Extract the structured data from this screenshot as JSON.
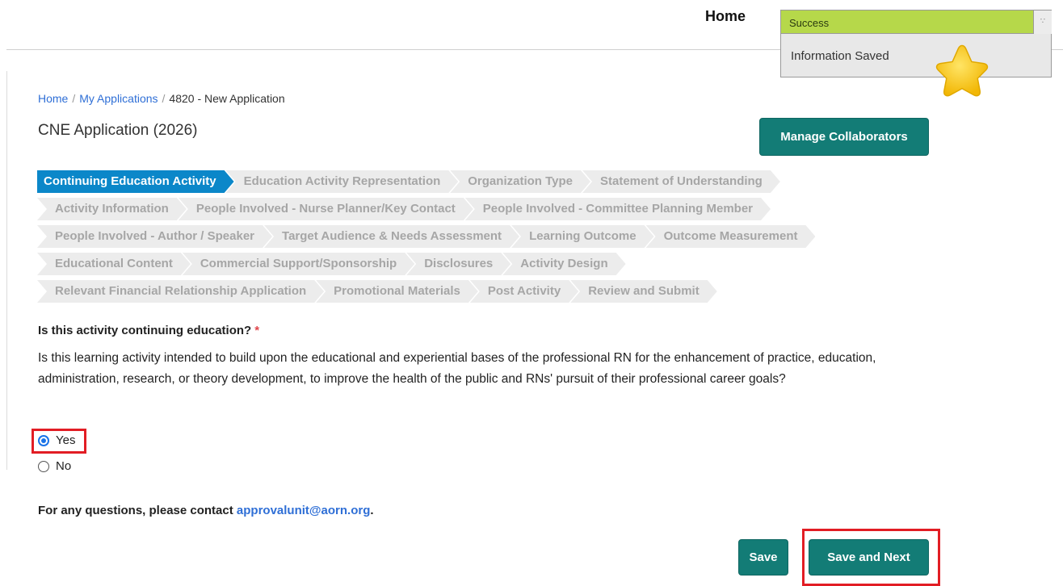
{
  "header": {
    "home_label": "Home"
  },
  "toast": {
    "title": "Success",
    "message": "Information Saved",
    "close_icon": "drag-handle-icon"
  },
  "breadcrumb": {
    "home": "Home",
    "my_applications": "My Applications",
    "current": "4820 - New Application",
    "separator": "/"
  },
  "page": {
    "title": "CNE Application (2026)",
    "manage_collaborators_label": "Manage Collaborators"
  },
  "steps": [
    [
      "Continuing Education Activity",
      "Education Activity Representation",
      "Organization Type",
      "Statement of Understanding"
    ],
    [
      "Activity Information",
      "People Involved - Nurse Planner/Key Contact",
      "People Involved - Committee Planning Member"
    ],
    [
      "People Involved - Author / Speaker",
      "Target Audience & Needs Assessment",
      "Learning Outcome",
      "Outcome Measurement"
    ],
    [
      "Educational Content",
      "Commercial Support/Sponsorship",
      "Disclosures",
      "Activity Design"
    ],
    [
      "Relevant Financial Relationship Application",
      "Promotional Materials",
      "Post Activity",
      "Review and Submit"
    ]
  ],
  "active_step": "Continuing Education Activity",
  "question": {
    "label": "Is this activity continuing education?",
    "required_mark": "*",
    "description": "Is this learning activity intended to build upon the educational and experiential bases of the professional RN for the enhancement of practice, education, administration, research, or theory development, to improve the health of the public and RNs' pursuit of their professional career goals?",
    "options": [
      {
        "label": "Yes",
        "selected": true
      },
      {
        "label": "No",
        "selected": false
      }
    ]
  },
  "contact": {
    "prefix": "For any questions, please contact ",
    "email": "approvalunit@aorn.org",
    "suffix": "."
  },
  "actions": {
    "save_label": "Save",
    "save_next_label": "Save and Next"
  },
  "colors": {
    "primary_button": "#137c76",
    "active_step": "#0b87c9",
    "toast_header": "#b6d84a",
    "highlight": "#e21d24",
    "link": "#2f6fd6"
  }
}
